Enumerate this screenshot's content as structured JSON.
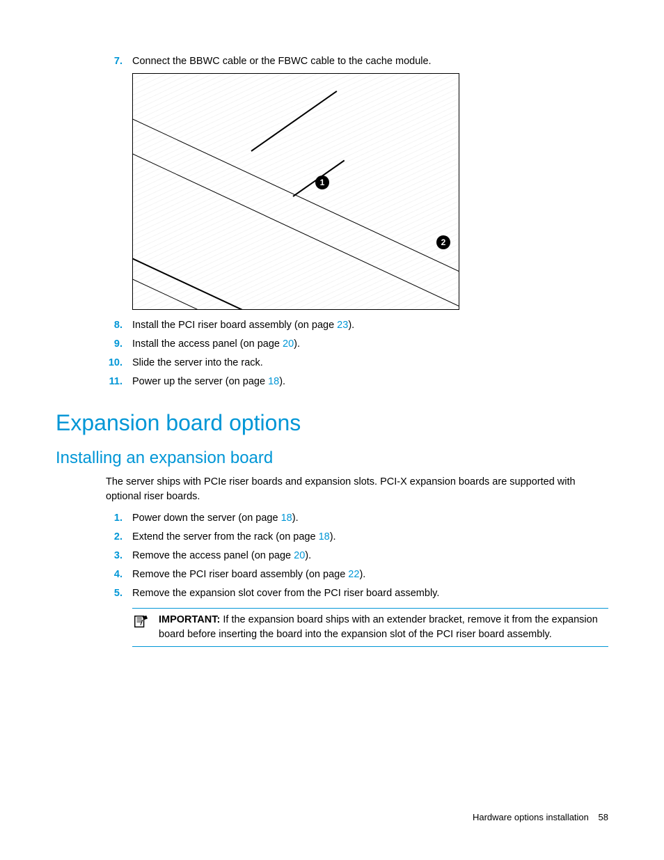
{
  "steps_a": [
    {
      "n": "7.",
      "text": "Connect the BBWC cable or the FBWC cable to the cache module."
    }
  ],
  "steps_b": [
    {
      "n": "8.",
      "pre": "Install the PCI riser board assembly (on page ",
      "link": "23",
      "post": ")."
    },
    {
      "n": "9.",
      "pre": "Install the access panel (on page ",
      "link": "20",
      "post": ")."
    },
    {
      "n": "10.",
      "text": "Slide the server into the rack."
    },
    {
      "n": "11.",
      "pre": "Power up the server (on page ",
      "link": "18",
      "post": ")."
    }
  ],
  "h1": "Expansion board options",
  "h2": "Installing an expansion board",
  "intro": "The server ships with PCIe riser boards and expansion slots. PCI-X expansion boards are supported with optional riser boards.",
  "steps_c": [
    {
      "n": "1.",
      "pre": "Power down the server (on page ",
      "link": "18",
      "post": ")."
    },
    {
      "n": "2.",
      "pre": "Extend the server from the rack (on page ",
      "link": "18",
      "post": ")."
    },
    {
      "n": "3.",
      "pre": "Remove the access panel (on page ",
      "link": "20",
      "post": ")."
    },
    {
      "n": "4.",
      "pre": "Remove the PCI riser board assembly (on page ",
      "link": "22",
      "post": ")."
    },
    {
      "n": "5.",
      "text": "Remove the expansion slot cover from the PCI riser board assembly."
    }
  ],
  "note": {
    "label": "IMPORTANT:",
    "body": "  If the expansion board ships with an extender bracket, remove it from the expansion board before inserting the board into the expansion slot of the PCI riser board assembly."
  },
  "callouts": {
    "c1": "1",
    "c2": "2"
  },
  "footer": {
    "section": "Hardware options installation",
    "page": "58"
  }
}
